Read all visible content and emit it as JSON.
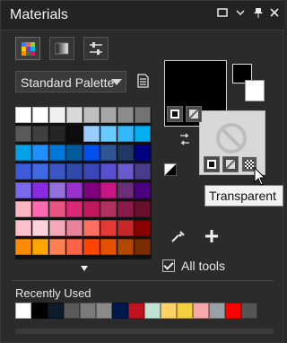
{
  "window": {
    "title": "Materials"
  },
  "tabs": [
    {
      "name": "palette-tab"
    },
    {
      "name": "gradient-tab"
    },
    {
      "name": "adjust-tab"
    }
  ],
  "palette_select": {
    "value": "Standard Palette"
  },
  "swatches": [
    [
      "#ffffff",
      "#ffffff",
      "#f0f0f0",
      "#d9d9d9",
      "#bfbfbf",
      "#a6a6a6",
      "#8c8c8c",
      "#737373"
    ],
    [
      "#595959",
      "#404040",
      "#262626",
      "#0d0d0d",
      "#99ccff",
      "#66ccff",
      "#33b7ff",
      "#00b0f0"
    ],
    [
      "#00a2e8",
      "#1e90ff",
      "#0078d7",
      "#005a9e",
      "#0050ef",
      "#2f5597",
      "#1f3864",
      "#000080"
    ],
    [
      "#3b5bdb",
      "#4169e1",
      "#3a56c5",
      "#2f4aa8",
      "#3b46b8",
      "#5a4fcf",
      "#6a5acd",
      "#483d8b"
    ],
    [
      "#7b68ee",
      "#8a2be2",
      "#9370db",
      "#9932cc",
      "#800080",
      "#c71585",
      "#6b2f7a",
      "#4b0082"
    ],
    [
      "#ffb6c1",
      "#ff69b4",
      "#e75480",
      "#db2777",
      "#c2185b",
      "#b03060",
      "#8b1a4a",
      "#6a0f2d"
    ],
    [
      "#ffc0cb",
      "#ffd1dc",
      "#f4a7b9",
      "#e8829a",
      "#ff6f61",
      "#e53935",
      "#c62828",
      "#8b0000"
    ],
    [
      "#ff8c00",
      "#ffa500",
      "#ff7f50",
      "#ff6347",
      "#ff4500",
      "#e65100",
      "#b34700",
      "#7a2e00"
    ]
  ],
  "foreground": {
    "color": "#000000"
  },
  "background": {
    "color": "#d8d8d8"
  },
  "tooltip": {
    "text": "Transparent"
  },
  "all_tools": {
    "label": "All tools",
    "checked": true
  },
  "recently_used": {
    "label": "Recently Used",
    "colors": [
      "#ffffff",
      "#000000",
      "#0d1b2a",
      "#5a5a5a",
      "#7a7a7a",
      "#8a8a8a",
      "#001a4d",
      "#c1121f",
      "#bfe3d0",
      "#ffd166",
      "#f4d03f",
      "#f7a8a8",
      "#9aa1a6",
      "#ff0000",
      "#555555"
    ]
  }
}
